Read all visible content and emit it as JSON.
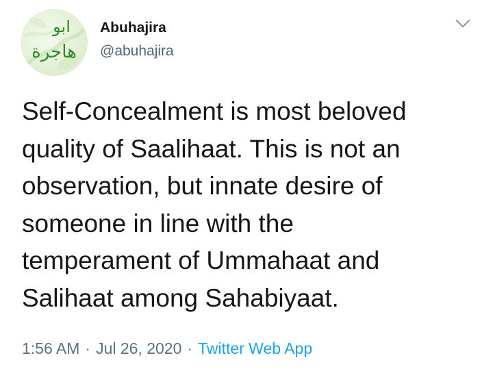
{
  "tweet": {
    "author": {
      "display_name": "Abuhajira",
      "handle": "@abuhajira",
      "avatar_text_line1": "ابو",
      "avatar_text_line2": "هاجرة",
      "avatar_bg_color": "#e4f1d8",
      "avatar_text_color": "#2e8b2a"
    },
    "menu_icon": "chevron-down-icon",
    "text_lines": [
      "Self-Concealment is most beloved",
      "quality of Saalihaat. This is not an",
      "observation, but innate desire of",
      "someone in line with the",
      "temperament of Ummahaat and",
      "Salihaat among Sahabiyaat."
    ],
    "meta": {
      "time": "1:56 AM",
      "separator": "·",
      "date": "Jul 26, 2020",
      "source": "Twitter Web App"
    },
    "colors": {
      "text": "#14171a",
      "secondary": "#5b7083",
      "link": "#1da1f2"
    }
  }
}
